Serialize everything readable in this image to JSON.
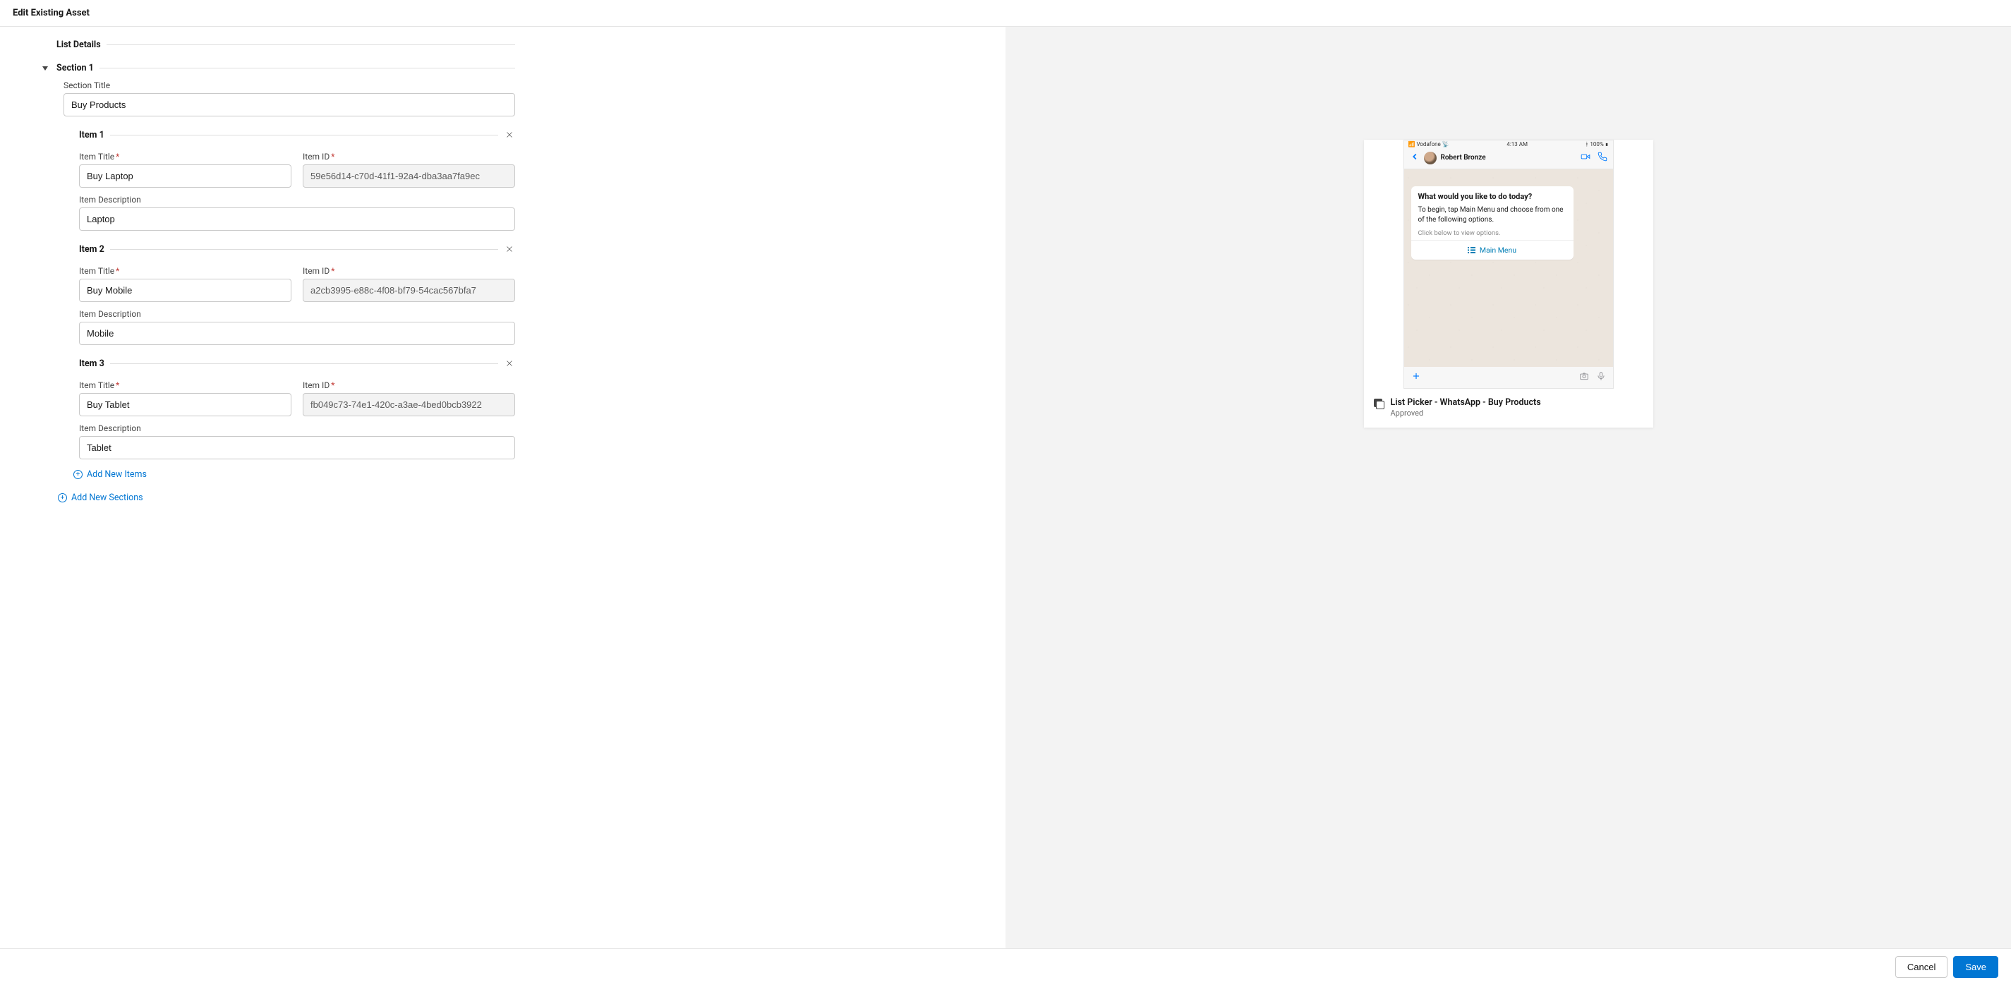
{
  "header": {
    "title": "Edit Existing Asset"
  },
  "form": {
    "list_details_label": "List Details",
    "section_label": "Section 1",
    "section_title_label": "Section Title",
    "section_title_value": "Buy Products",
    "item_title_label": "Item Title",
    "item_id_label": "Item ID",
    "item_desc_label": "Item Description",
    "items": [
      {
        "header": "Item 1",
        "title": "Buy Laptop",
        "id": "59e56d14-c70d-41f1-92a4-dba3aa7fa9ec",
        "desc": "Laptop"
      },
      {
        "header": "Item 2",
        "title": "Buy Mobile",
        "id": "a2cb3995-e88c-4f08-bf79-54cac567bfa7",
        "desc": "Mobile"
      },
      {
        "header": "Item 3",
        "title": "Buy Tablet",
        "id": "fb049c73-74e1-420c-a3ae-4bed0bcb3922",
        "desc": "Tablet"
      }
    ],
    "add_items_label": "Add New Items",
    "add_sections_label": "Add New Sections"
  },
  "preview": {
    "status": {
      "carrier": "Vodafone",
      "time": "4:13 AM",
      "battery": "100%"
    },
    "contact_name": "Robert Bronze",
    "bubble": {
      "title": "What would you like to do today?",
      "body": "To begin, tap Main Menu and choose from one of the following options.",
      "hint": "Click below to view options.",
      "action": "Main Menu"
    },
    "meta": {
      "title": "List Picker - WhatsApp - Buy Products",
      "status": "Approved"
    }
  },
  "footer": {
    "cancel": "Cancel",
    "save": "Save"
  }
}
